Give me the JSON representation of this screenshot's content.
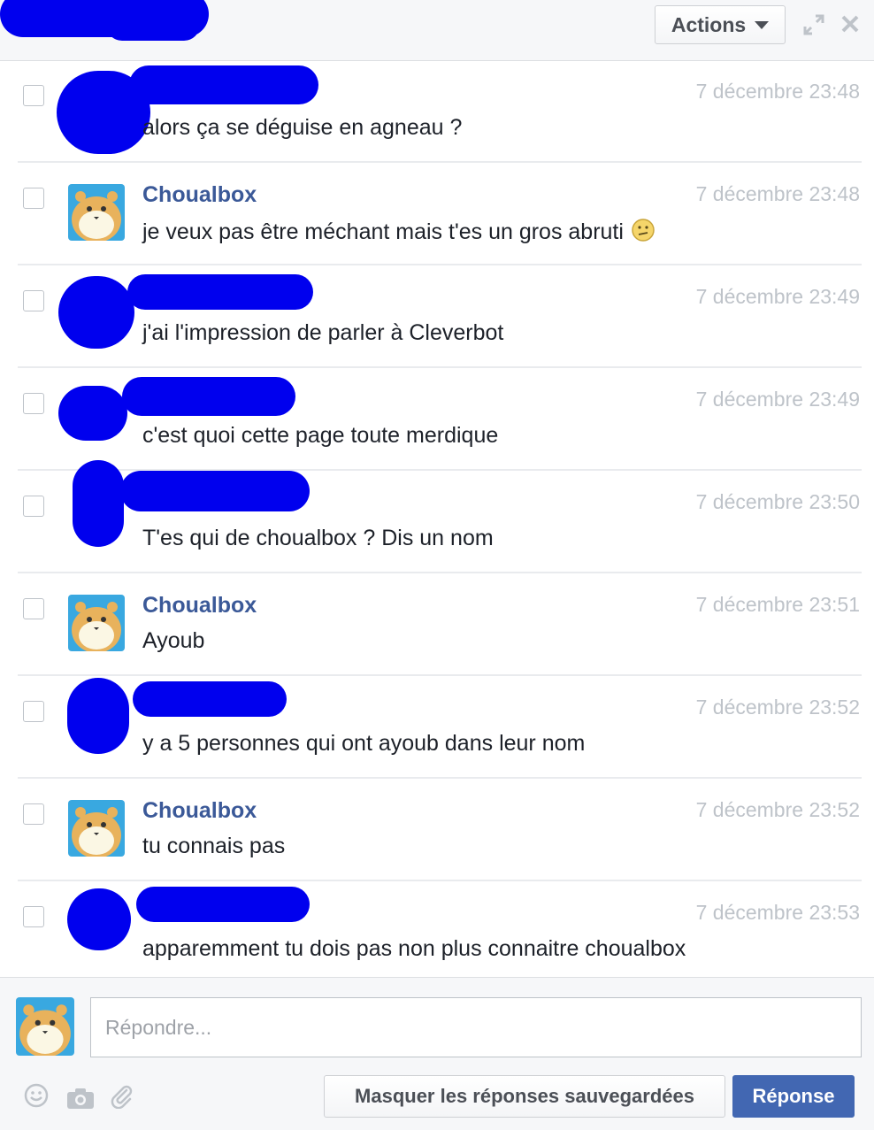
{
  "header": {
    "actions_label": "Actions"
  },
  "colors": {
    "link_blue": "#3b5998",
    "timestamp_gray": "#bec3c9",
    "primary_button": "#4267b2",
    "redaction_blue": "#0000ee"
  },
  "messages": [
    {
      "sender": "",
      "redacted": true,
      "time": "7 décembre 23:48",
      "text": "alors ça se déguise en agneau ?"
    },
    {
      "sender": "Choualbox",
      "redacted": false,
      "time": "7 décembre 23:48",
      "text": "je veux pas être méchant mais t'es un gros abruti",
      "emoji": "confused-face-icon"
    },
    {
      "sender": "",
      "redacted": true,
      "time": "7 décembre 23:49",
      "text": "j'ai l'impression de parler à Cleverbot"
    },
    {
      "sender": "",
      "redacted": true,
      "time": "7 décembre 23:49",
      "text": "c'est quoi cette page toute merdique"
    },
    {
      "sender": "",
      "redacted": true,
      "time": "7 décembre 23:50",
      "text": "T'es qui de choualbox ? Dis un nom"
    },
    {
      "sender": "Choualbox",
      "redacted": false,
      "time": "7 décembre 23:51",
      "text": "Ayoub"
    },
    {
      "sender": "",
      "redacted": true,
      "time": "7 décembre 23:52",
      "text": "y a 5 personnes qui ont ayoub dans leur nom"
    },
    {
      "sender": "Choualbox",
      "redacted": false,
      "time": "7 décembre 23:52",
      "text": "tu connais pas"
    },
    {
      "sender": "",
      "redacted": true,
      "time": "7 décembre 23:53",
      "text": "apparemment tu dois pas non plus connaitre choualbox"
    }
  ],
  "composer": {
    "placeholder": "Répondre...",
    "hide_saved_label": "Masquer les réponses sauvegardées",
    "reply_label": "Réponse"
  }
}
